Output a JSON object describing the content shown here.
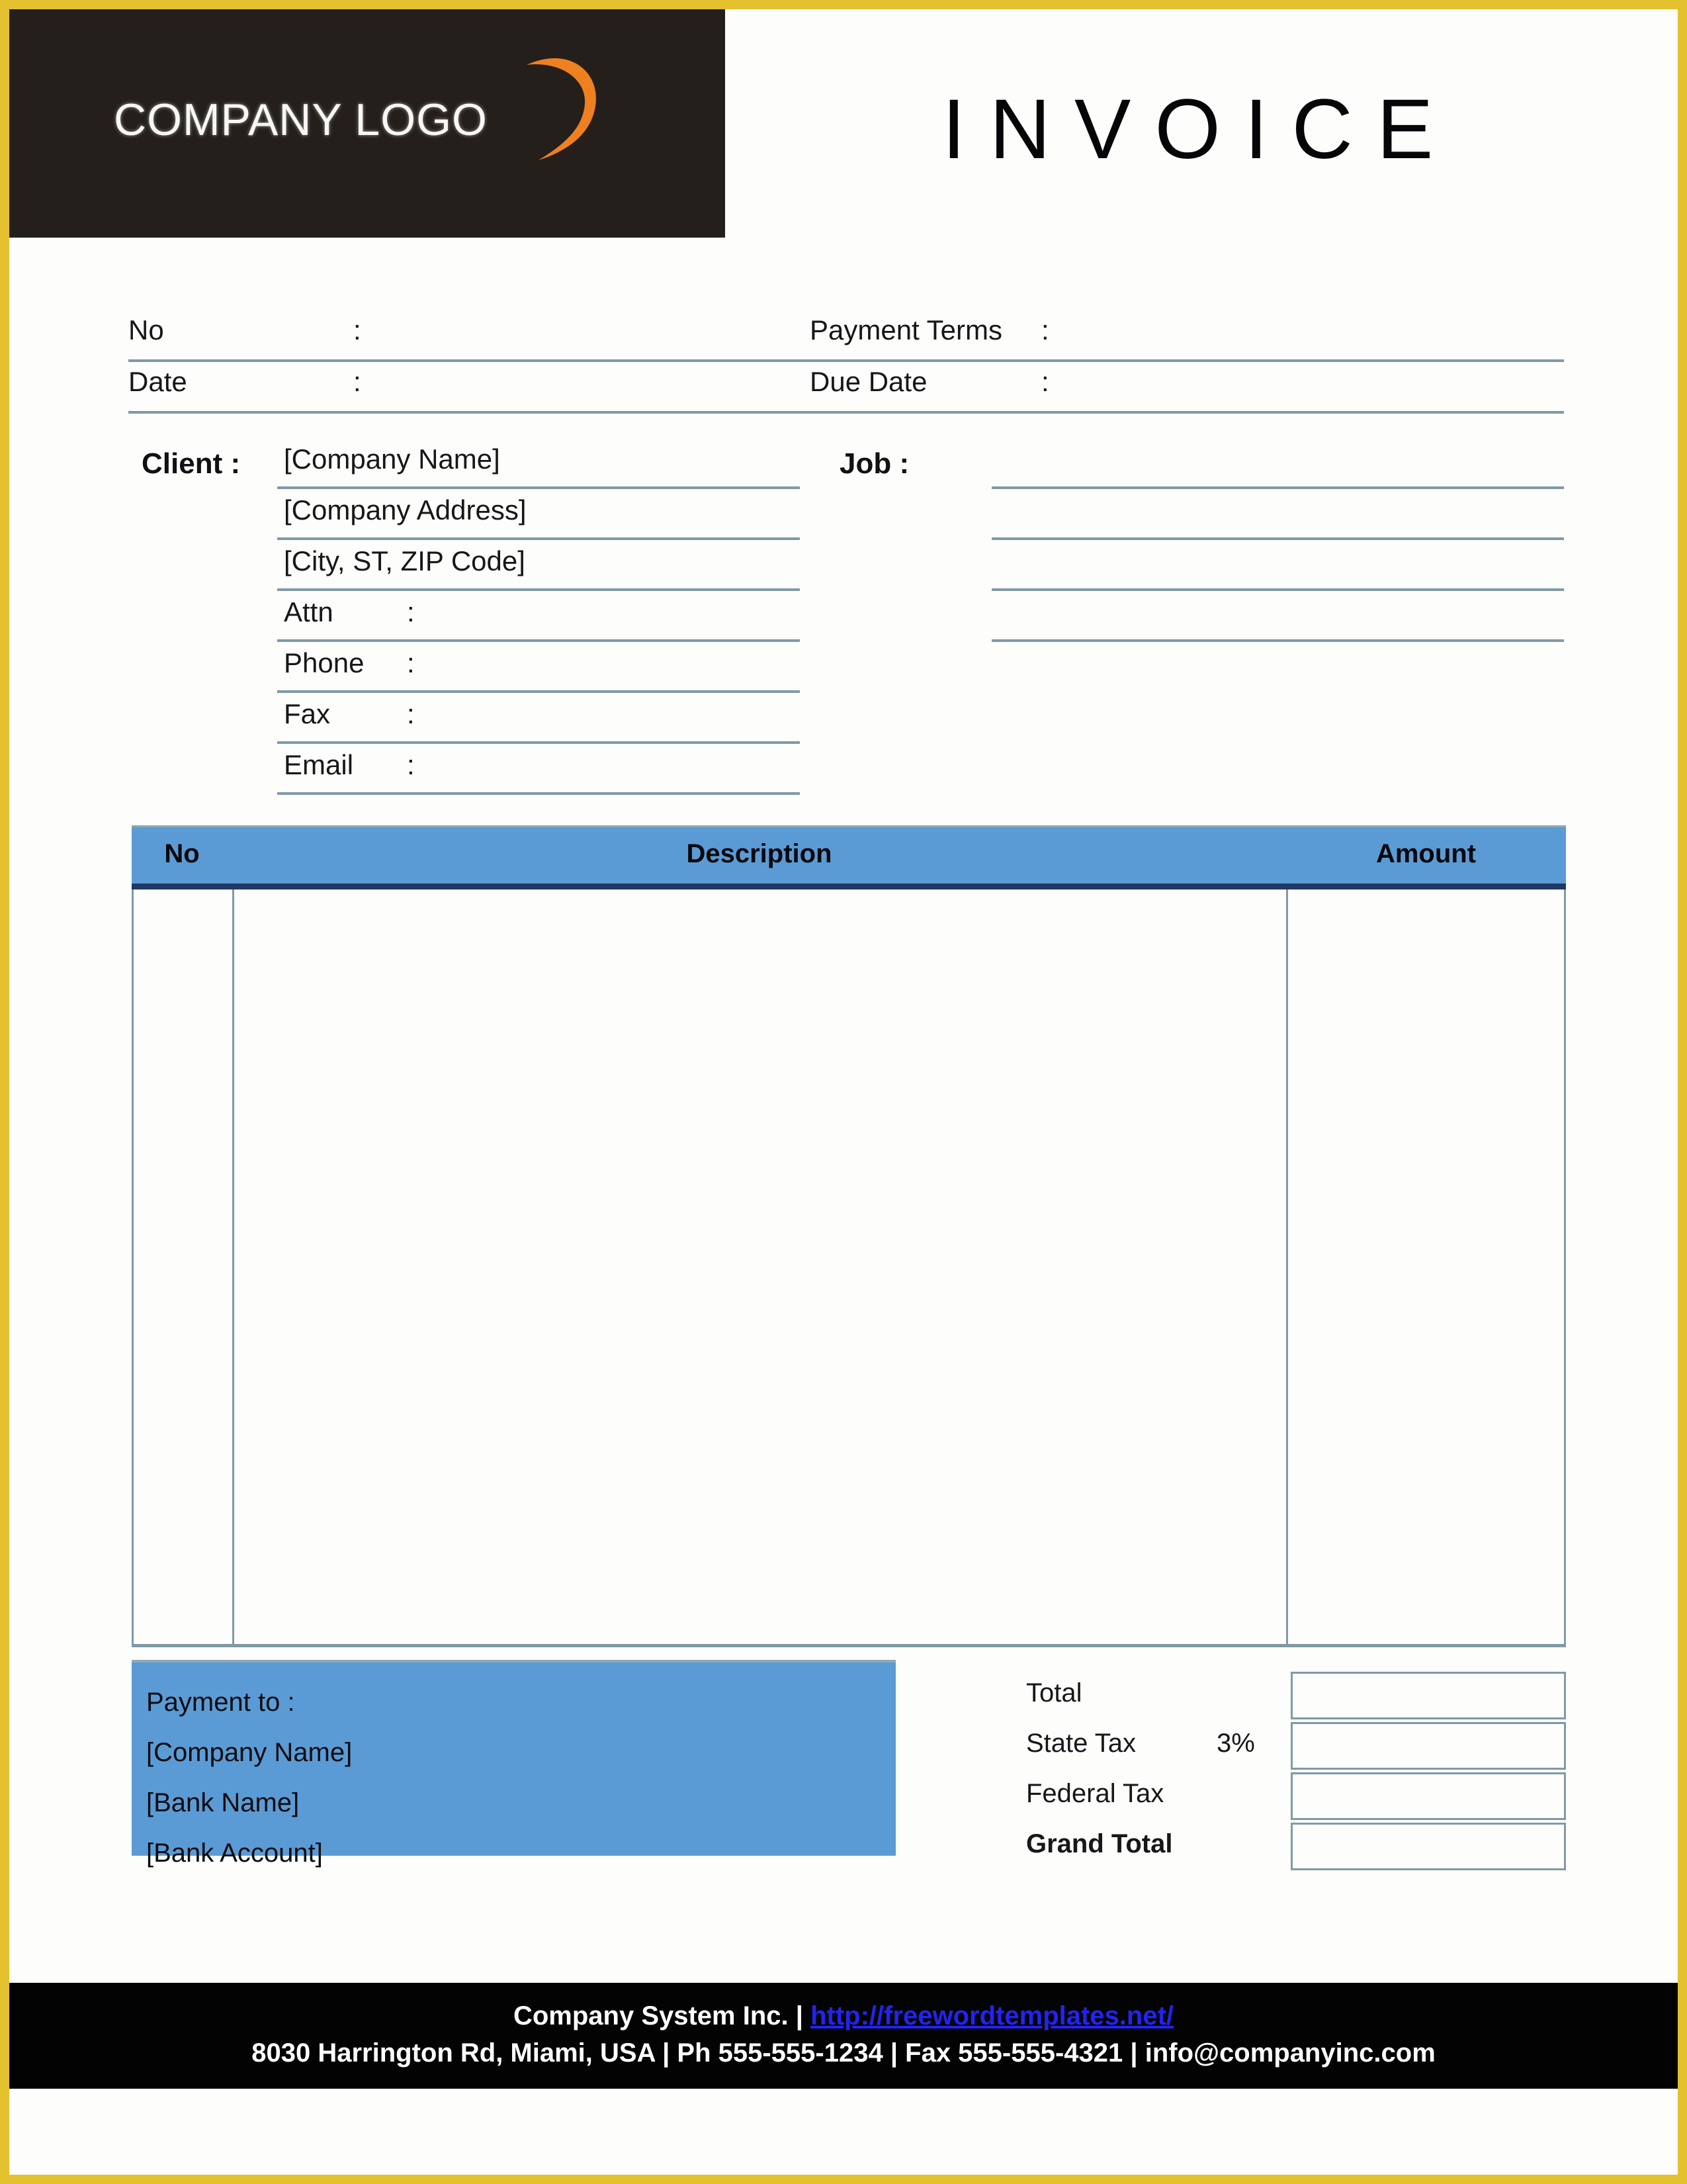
{
  "page": {
    "border_color": "#e3c02e",
    "background": "#fdfdfb"
  },
  "header": {
    "logo_text": "COMPANY LOGO",
    "logo_swoosh_color": "#ee8020",
    "dark_bg": "#241f1a",
    "title": "INVOICE"
  },
  "meta": {
    "rows": [
      {
        "left_label": "No",
        "left_colon": ":",
        "left_value": "",
        "right_label": "Payment  Terms",
        "right_colon": ":",
        "right_value": ""
      },
      {
        "left_label": "Date",
        "left_colon": ":",
        "left_value": "",
        "right_label": "Due Date",
        "right_colon": ":",
        "right_value": ""
      }
    ]
  },
  "client": {
    "title": "Client  :",
    "lines": [
      {
        "kind": "value",
        "text": "[Company Name]"
      },
      {
        "kind": "value",
        "text": "[Company Address]"
      },
      {
        "kind": "value",
        "text": "[City, ST, ZIP Code]"
      },
      {
        "kind": "field",
        "label": "Attn",
        "colon": ":",
        "value": ""
      },
      {
        "kind": "field",
        "label": "Phone",
        "colon": ":",
        "value": ""
      },
      {
        "kind": "field",
        "label": "Fax",
        "colon": ":",
        "value": ""
      },
      {
        "kind": "field",
        "label": "Email",
        "colon": ":",
        "value": ""
      }
    ]
  },
  "job": {
    "title": "Job  :",
    "lines": [
      "",
      "",
      "",
      ""
    ]
  },
  "items_table": {
    "header_bg": "#5b9bd5",
    "header_rule": "#1f3864",
    "columns": [
      "No",
      "Description",
      "Amount"
    ],
    "rows": []
  },
  "payment": {
    "bg": "#5b9bd5",
    "lines": [
      "Payment to :",
      "[Company Name]",
      "[Bank Name]",
      "[Bank Account]"
    ]
  },
  "totals": {
    "rows": [
      {
        "label": "Total",
        "pct": "",
        "value": "",
        "bold": false
      },
      {
        "label": "State Tax",
        "pct": "3%",
        "value": "",
        "bold": false
      },
      {
        "label": "Federal Tax",
        "pct": "",
        "value": "",
        "bold": false
      },
      {
        "label": "Grand Total",
        "pct": "",
        "value": "",
        "bold": true
      }
    ]
  },
  "footer": {
    "company": "Company System Inc. |",
    "url": "http://freewordtemplates.net/",
    "address": "8030 Harrington Rd, Miami, USA | Ph 555-555-1234 | Fax 555-555-4321 | info@companyinc.com",
    "link_color": "#2323f0"
  }
}
